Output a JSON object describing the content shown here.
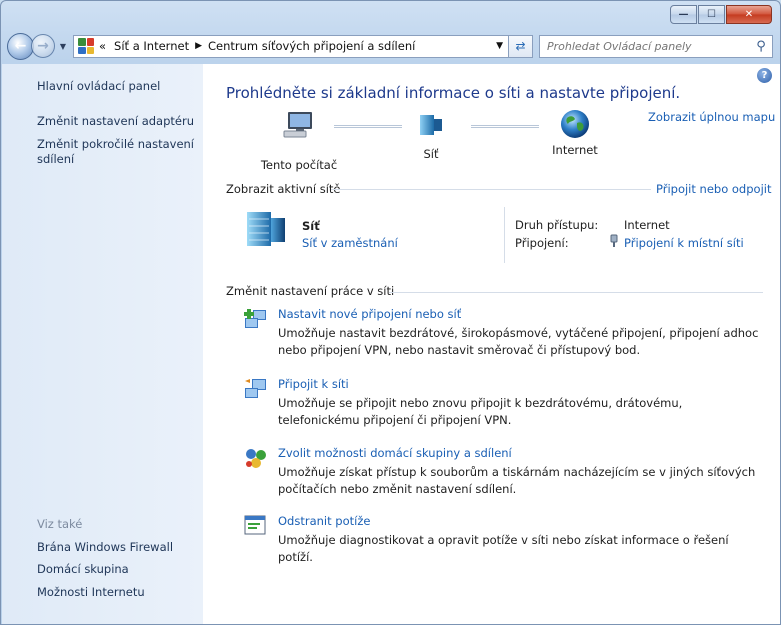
{
  "address": {
    "prefix": "«",
    "crumbs": [
      "Síť a Internet",
      "Centrum síťových připojení a sdílení"
    ]
  },
  "search": {
    "placeholder": "Prohledat Ovládací panely"
  },
  "caption": {
    "minimize": "—",
    "maximize": "☐",
    "close": "✕"
  },
  "left_pane": {
    "home": "Hlavní ovládací panel",
    "links": [
      "Změnit nastavení adaptéru",
      "Změnit pokročilé nastavení sdílení"
    ],
    "see_also_label": "Viz také",
    "see_also": [
      "Brána Windows Firewall",
      "Domácí skupina",
      "Možnosti Internetu"
    ]
  },
  "main": {
    "help": "?",
    "title": "Prohlédněte si základní informace o síti a nastavte připojení.",
    "full_map": "Zobrazit úplnou mapu",
    "map": {
      "computer": "Tento počítač",
      "network": "Síť",
      "internet": "Internet"
    },
    "active_header": "Zobrazit aktivní sítě",
    "connect_link": "Připojit nebo odpojit",
    "active": {
      "name": "Síť",
      "type": "Síť v zaměstnání",
      "access_label": "Druh přístupu:",
      "access_value": "Internet",
      "conn_label": "Připojení:",
      "conn_value": "Připojení k místní síti"
    },
    "change_header": "Změnit nastavení práce v síti",
    "tasks": [
      {
        "title": "Nastavit nové připojení nebo síť",
        "desc": "Umožňuje nastavit bezdrátové, širokopásmové, vytáčené připojení, připojení adhoc nebo připojení VPN, nebo nastavit směrovač či přístupový bod."
      },
      {
        "title": "Připojit k síti",
        "desc": "Umožňuje se připojit nebo znovu připojit k bezdrátovému, drátovému, telefonickému připojení či připojení VPN."
      },
      {
        "title": "Zvolit možnosti domácí skupiny a sdílení",
        "desc": "Umožňuje získat přístup k souborům a tiskárnám nacházejícím se v jiných síťových počítačích nebo změnit nastavení sdílení."
      },
      {
        "title": "Odstranit potíže",
        "desc": "Umožňuje diagnostikovat a opravit potíže v síti nebo získat informace o řešení potíží."
      }
    ]
  }
}
